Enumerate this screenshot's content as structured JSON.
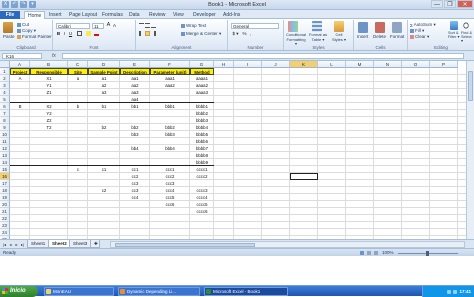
{
  "window": {
    "title": "Book1 - Microsoft Excel",
    "qat": [
      "X",
      "↶",
      "↷",
      "▾"
    ],
    "controls": [
      "—",
      "❐",
      "✕"
    ]
  },
  "tabs": [
    "File",
    "Home",
    "Insert",
    "Page Layout",
    "Formulas",
    "Data",
    "Review",
    "View",
    "Developer",
    "Add-Ins"
  ],
  "active_tab": "Home",
  "ribbon": {
    "clipboard": {
      "paste": "Paste",
      "cut": "Cut",
      "copy": "Copy ▾",
      "format_painter": "Format Painter",
      "label": "Clipboard"
    },
    "font": {
      "name": "Calibri",
      "size": "11",
      "bold": "B",
      "italic": "I",
      "underline": "U",
      "grow": "A",
      "shrink": "A",
      "label": "Font"
    },
    "alignment": {
      "wrap_text": "Wrap Text",
      "merge": "Merge & Center ▾",
      "label": "Alignment"
    },
    "number": {
      "format": "General",
      "currency": "$ ▾",
      "percent": "%",
      "comma": ",",
      "label": "Number"
    },
    "styles": {
      "conditional": "Conditional Formatting ▾",
      "format_table": "Format as Table ▾",
      "cell_styles": "Cell Styles ▾",
      "label": "Styles"
    },
    "cells": {
      "insert": "Insert",
      "delete": "Delete",
      "format": "Format",
      "label": "Cells"
    },
    "editing": {
      "autosum": "AutoSum ▾",
      "fill": "Fill ▾",
      "clear": "Clear ▾",
      "sort": "Sort & Filter ▾",
      "find": "Find & Select ▾",
      "label": "Editing"
    }
  },
  "formula_bar": {
    "name_box": "K16",
    "fx": "fx",
    "value": ""
  },
  "columns": [
    "A",
    "B",
    "C",
    "D",
    "E",
    "F",
    "G",
    "H",
    "I",
    "J",
    "K",
    "L",
    "M",
    "N",
    "O",
    "P"
  ],
  "selected_column": "K",
  "selected_row": "16",
  "rows": [
    "1",
    "2",
    "3",
    "4",
    "5",
    "6",
    "7",
    "8",
    "9",
    "10",
    "11",
    "12",
    "13",
    "14",
    "15",
    "16",
    "17",
    "18",
    "19",
    "20",
    "21",
    "22",
    "23",
    "24",
    "25"
  ],
  "table_headers": [
    "Project",
    "Responsible",
    "Site",
    "Sample Point",
    "Description",
    "Parameter (unit)",
    "Method"
  ],
  "table_rows": [
    [
      "A",
      "X1",
      "a",
      "a1",
      "aa1",
      "aaa1",
      "aaaa1"
    ],
    [
      "",
      "Y1",
      "",
      "a2",
      "aa2",
      "aaa2",
      "aaaa2"
    ],
    [
      "",
      "Z1",
      "",
      "a3",
      "aa3",
      "",
      "aaaa3"
    ],
    [
      "",
      "",
      "",
      "",
      "aa4",
      "",
      ""
    ],
    [
      "B",
      "X2",
      "b",
      "b1",
      "bb1",
      "bbb1",
      "bbbb1"
    ],
    [
      "",
      "Y2",
      "",
      "",
      "",
      "",
      "bbbb2"
    ],
    [
      "",
      "Z2",
      "",
      "",
      "",
      "",
      "bbbb3"
    ],
    [
      "",
      "T2",
      "",
      "b2",
      "bb2",
      "bbb2",
      "bbbb4"
    ],
    [
      "",
      "",
      "",
      "",
      "bb3",
      "bbb3",
      "bbbb5"
    ],
    [
      "",
      "",
      "",
      "",
      "",
      "",
      "bbbb6"
    ],
    [
      "",
      "",
      "",
      "",
      "bb4",
      "bbb4",
      "bbbb7"
    ],
    [
      "",
      "",
      "",
      "",
      "",
      "",
      "bbbb8"
    ],
    [
      "",
      "",
      "",
      "",
      "",
      "",
      "bbbb9"
    ],
    [
      "",
      "",
      "c",
      "c1",
      "cc1",
      "ccc1",
      "cccc1"
    ],
    [
      "",
      "",
      "",
      "",
      "cc2",
      "ccc2",
      "cccc2"
    ],
    [
      "",
      "",
      "",
      "",
      "cc3",
      "ccc3",
      ""
    ],
    [
      "",
      "",
      "",
      "c2",
      "cc3",
      "ccc4",
      "cccc3"
    ],
    [
      "",
      "",
      "",
      "",
      "cc4",
      "ccc5",
      "cccc4"
    ],
    [
      "",
      "",
      "",
      "",
      "",
      "ccc6",
      "cccc5"
    ],
    [
      "",
      "",
      "",
      "",
      "",
      "",
      "cccc6"
    ]
  ],
  "sheets": [
    "Sheet1",
    "Sheet2",
    "Sheet3"
  ],
  "active_sheet": "Sheet2",
  "status": {
    "ready": "Ready",
    "zoom": "100%"
  },
  "taskbar": {
    "start": "Inicio",
    "tasks": [
      "MonEAU",
      "Dynamic Depending Li...",
      "Microsoft Excel - Book1"
    ],
    "time": "17:41"
  }
}
